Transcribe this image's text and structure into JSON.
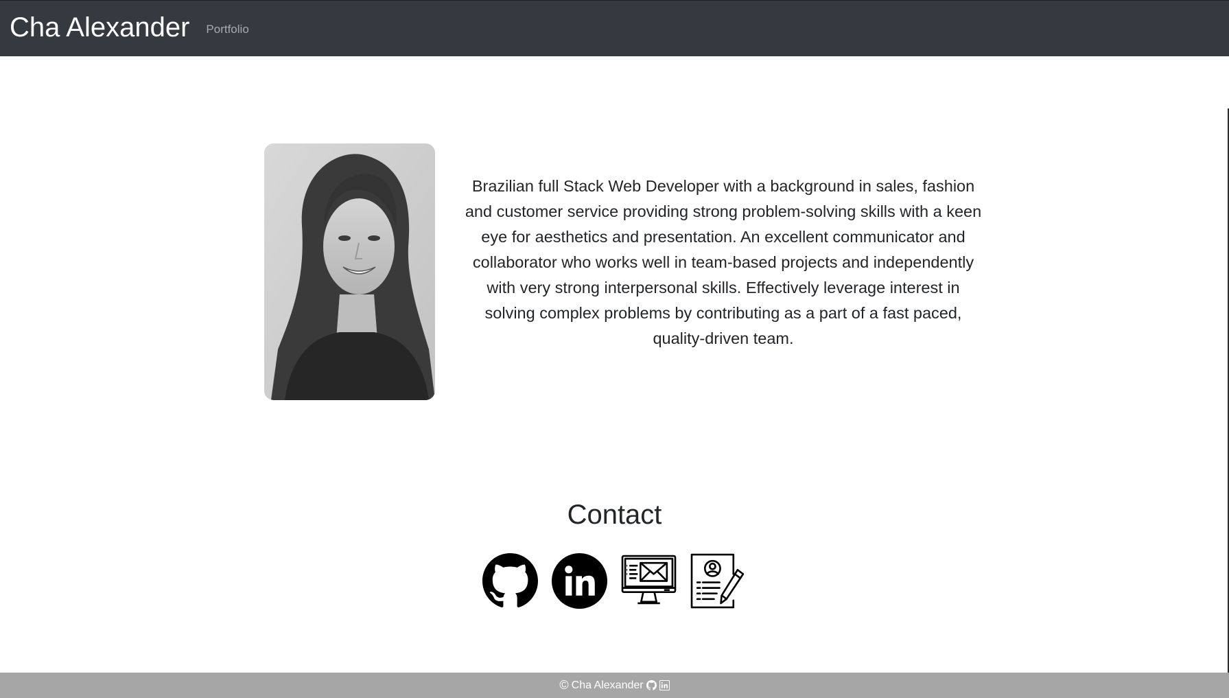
{
  "navbar": {
    "brand": "Cha Alexander",
    "links": [
      {
        "label": "Portfolio"
      }
    ]
  },
  "about": {
    "photo_icon": "profile-photo",
    "bio": "Brazilian full Stack Web Developer with a background in sales, fashion and customer service providing strong problem-solving skills with a keen eye for aesthetics and presentation. An excellent communicator and collaborator who works well in team-based projects and independently with very strong interpersonal skills. Effectively leverage interest in solving complex problems by contributing as a part of a fast paced, quality-driven team."
  },
  "contact": {
    "title": "Contact",
    "icons": [
      "github-icon",
      "linkedin-icon",
      "email-computer-icon",
      "resume-icon"
    ]
  },
  "footer": {
    "copyright_symbol": "©",
    "name": "Cha Alexander",
    "icons": [
      "github-icon",
      "linkedin-icon"
    ]
  },
  "colors": {
    "navbar_bg": "#343a40",
    "brand_text": "#ffffff",
    "nav_link": "#a5abb1",
    "body_text": "#212529",
    "footer_bg": "#a6a6a6",
    "footer_text": "#ffffff"
  }
}
